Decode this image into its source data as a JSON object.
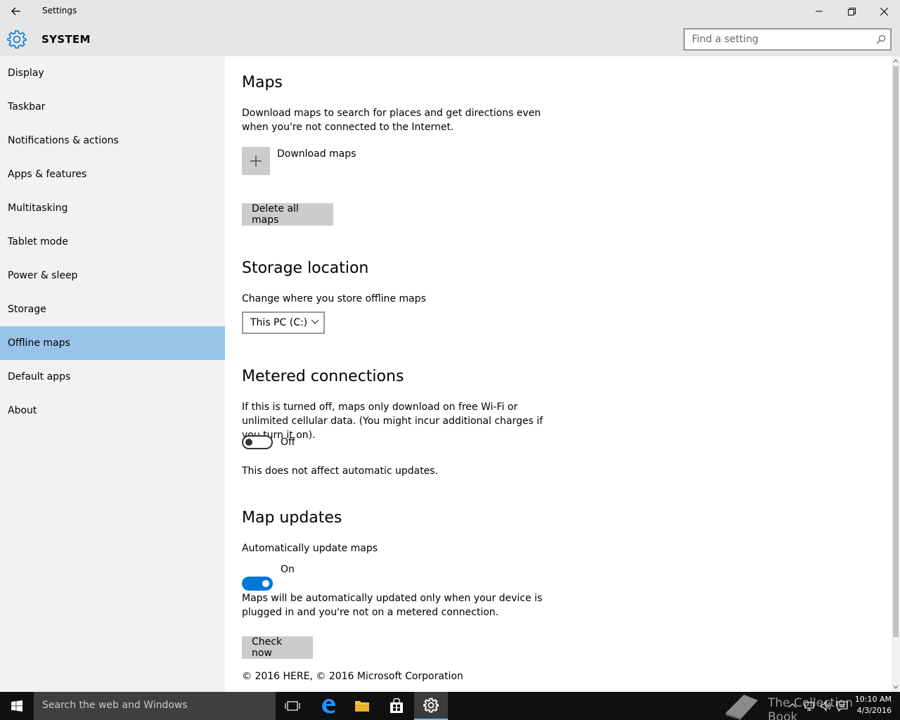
{
  "window": {
    "title": "Settings"
  },
  "header": {
    "section": "SYSTEM",
    "search_placeholder": "Find a setting"
  },
  "sidebar": {
    "items": [
      {
        "label": "Display"
      },
      {
        "label": "Taskbar"
      },
      {
        "label": "Notifications & actions"
      },
      {
        "label": "Apps & features"
      },
      {
        "label": "Multitasking"
      },
      {
        "label": "Tablet mode"
      },
      {
        "label": "Power & sleep"
      },
      {
        "label": "Storage"
      },
      {
        "label": "Offline maps"
      },
      {
        "label": "Default apps"
      },
      {
        "label": "About"
      }
    ],
    "selected": "Offline maps"
  },
  "maps": {
    "title": "Maps",
    "description": "Download maps to search for places and get directions even when you're not connected to the Internet.",
    "download_label": "Download maps",
    "delete_label": "Delete all maps"
  },
  "storage": {
    "title": "Storage location",
    "description": "Change where you store offline maps",
    "selected_value": "This PC (C:)"
  },
  "metered": {
    "title": "Metered connections",
    "description": "If this is turned off, maps only download on free Wi-Fi or unlimited cellular data. (You might incur additional charges if you turn it on).",
    "toggle_state": "Off",
    "note": "This does not affect automatic updates."
  },
  "updates": {
    "title": "Map updates",
    "toggle_label": "Automatically update maps",
    "toggle_state": "On",
    "description": "Maps will be automatically updated only when your device is plugged in and you're not on a metered connection.",
    "check_label": "Check now"
  },
  "footer": {
    "copyright": "© 2016 HERE, © 2016 Microsoft Corporation"
  },
  "taskbar": {
    "search_placeholder": "Search the web and Windows",
    "watermark": "The Collection Book",
    "time": "10:10 AM",
    "date": "4/3/2016"
  },
  "colors": {
    "accent": "#0078d7",
    "selected_nav": "#99c3e9",
    "chrome": "#e6e6e6",
    "sidebar": "#f2f2f2"
  }
}
